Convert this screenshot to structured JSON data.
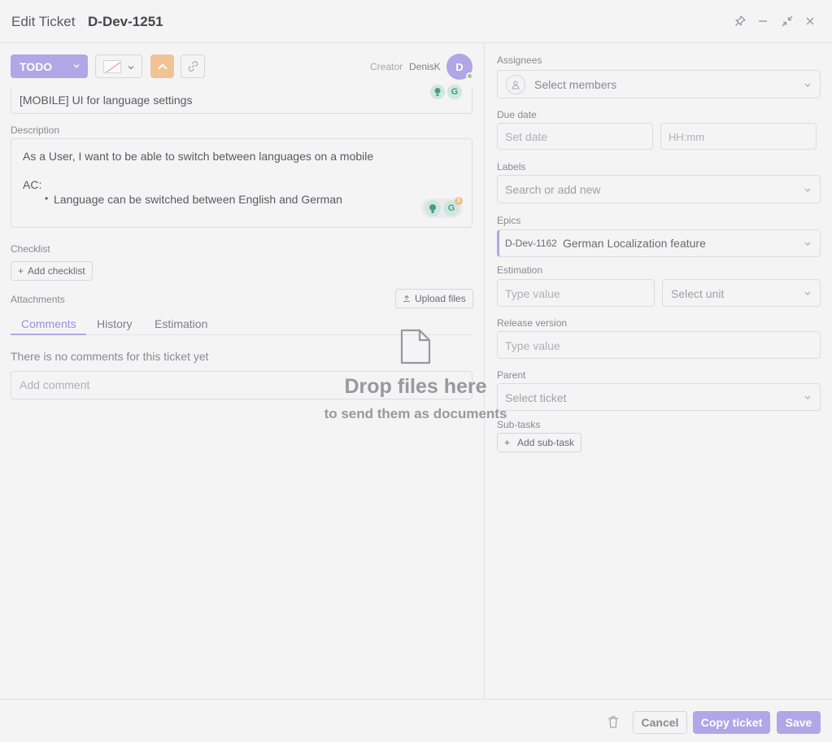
{
  "header": {
    "title": "Edit Ticket",
    "ticket_id": "D-Dev-1251"
  },
  "toolbar": {
    "status_label": "TODO",
    "status_color": "#b1a6e6",
    "priority_color": "#f0c394",
    "creator_label": "Creator",
    "creator_name": "DenisK",
    "avatar_initial": "D"
  },
  "ticket": {
    "title_value": "[MOBILE] UI for language settings",
    "description_label": "Description",
    "description_line1": "As a User, I want to be able to switch between languages on a mobile",
    "description_line2": "AC:",
    "description_bullet": "Language can be switched between English and German",
    "grammarly_badge": "1"
  },
  "checklist": {
    "label": "Checklist",
    "add_label": "Add checklist"
  },
  "attachments": {
    "label": "Attachments",
    "upload_label": "Upload files"
  },
  "tabs": [
    {
      "label": "Comments",
      "active": true
    },
    {
      "label": "History",
      "active": false
    },
    {
      "label": "Estimation",
      "active": false
    }
  ],
  "comments": {
    "empty_text": "There is no comments for this ticket yet",
    "input_placeholder": "Add comment"
  },
  "dropzone": {
    "title": "Drop files here",
    "subtitle": "to send them as documents"
  },
  "sidebar": {
    "assignees": {
      "label": "Assignees",
      "placeholder": "Select members"
    },
    "due_date": {
      "label": "Due date",
      "date_placeholder": "Set date",
      "time_placeholder": "HH:mm"
    },
    "labels": {
      "label": "Labels",
      "placeholder": "Search or add new"
    },
    "epics": {
      "label": "Epics",
      "epic_id": "D-Dev-1162",
      "epic_name": "German Localization feature"
    },
    "estimation": {
      "label": "Estimation",
      "value_placeholder": "Type value",
      "unit_placeholder": "Select unit"
    },
    "release_version": {
      "label": "Release version",
      "placeholder": "Type value"
    },
    "parent": {
      "label": "Parent",
      "placeholder": "Select ticket"
    },
    "subtasks": {
      "label": "Sub-tasks",
      "add_label": "Add sub-task"
    }
  },
  "footer": {
    "cancel_label": "Cancel",
    "copy_label": "Copy ticket",
    "save_label": "Save"
  }
}
